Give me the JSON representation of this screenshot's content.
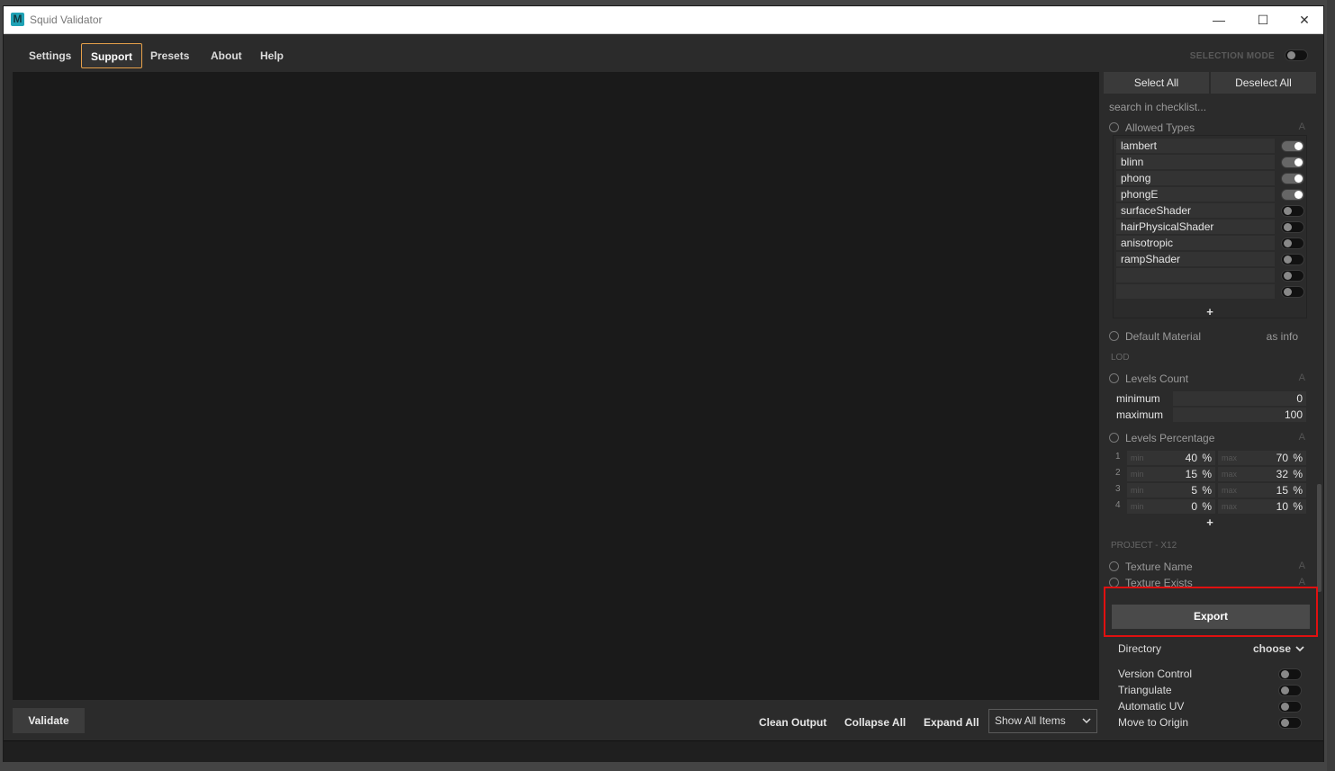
{
  "window": {
    "title": "Squid Validator",
    "app_icon": "M",
    "minimize": "—",
    "maximize": "☐",
    "close": "✕"
  },
  "menu": {
    "items": [
      "Settings",
      "Support",
      "Presets",
      "About",
      "Help"
    ],
    "active": "Support",
    "selection_mode_label": "SELECTION MODE"
  },
  "panel": {
    "select_all": "Select All",
    "deselect_all": "Deselect All",
    "search_placeholder": "search in checklist...",
    "allowed_types": {
      "label": "Allowed Types",
      "mark": "A",
      "items": [
        {
          "name": "lambert",
          "on": true
        },
        {
          "name": "blinn",
          "on": true
        },
        {
          "name": "phong",
          "on": true
        },
        {
          "name": "phongE",
          "on": true
        },
        {
          "name": "surfaceShader",
          "on": false
        },
        {
          "name": "hairPhysicalShader",
          "on": false
        },
        {
          "name": "anisotropic",
          "on": false
        },
        {
          "name": "rampShader",
          "on": false
        },
        {
          "name": "",
          "on": false
        },
        {
          "name": "",
          "on": false
        }
      ],
      "add": "+"
    },
    "default_material": {
      "label": "Default Material",
      "mode": "as info"
    },
    "lod_header": "LOD",
    "levels_count": {
      "label": "Levels Count",
      "mark": "A",
      "minimum_label": "minimum",
      "minimum": "0",
      "maximum_label": "maximum",
      "maximum": "100"
    },
    "levels_percentage": {
      "label": "Levels Percentage",
      "mark": "A",
      "min_placeholder": "min",
      "max_placeholder": "max",
      "unit": "%",
      "rows": [
        {
          "idx": "1",
          "min": "40",
          "max": "70"
        },
        {
          "idx": "2",
          "min": "15",
          "max": "32"
        },
        {
          "idx": "3",
          "min": "5",
          "max": "15"
        },
        {
          "idx": "4",
          "min": "0",
          "max": "10"
        }
      ],
      "add": "+"
    },
    "project_header": "PROJECT - X12",
    "texture_name": {
      "label": "Texture Name",
      "mark": "A"
    },
    "texture_exists": {
      "label": "Texture Exists",
      "mark": "A"
    },
    "export": {
      "button": "Export",
      "directory_label": "Directory",
      "directory_value": "choose",
      "options": [
        {
          "label": "Version Control",
          "on": false
        },
        {
          "label": "Triangulate",
          "on": false
        },
        {
          "label": "Automatic UV",
          "on": false
        },
        {
          "label": "Move to Origin",
          "on": false
        }
      ]
    }
  },
  "bottom": {
    "validate": "Validate",
    "clean_output": "Clean Output",
    "collapse_all": "Collapse All",
    "expand_all": "Expand All",
    "show_filter": "Show All Items"
  }
}
